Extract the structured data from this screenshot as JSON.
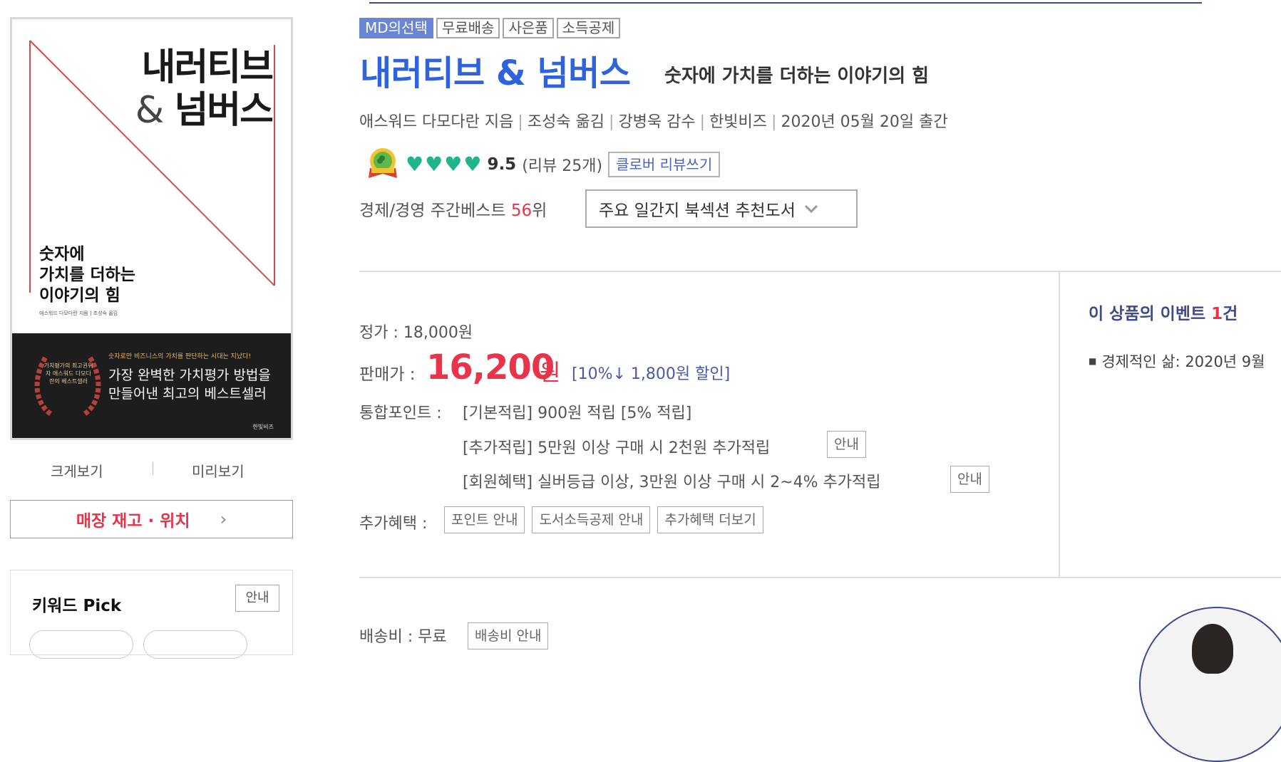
{
  "cover": {
    "title_line1": "내러티브",
    "title_amp": "&",
    "title_line2": "넘버스",
    "subtitle_lines": [
      "숫자에",
      "가치를 더하는",
      "이야기의 힘"
    ],
    "author_small": "애스워드 다모다란 지음 | 조성숙 옮김",
    "wreath_text": "가치평가의 최고권위자 애스워드 다모다란의 베스트셀러",
    "blurb_small": "숫자로만 비즈니스의 가치를 판단하는 시대는 지났다!",
    "blurb_large": "가장 완벽한 가치평가 방법을 만들어낸 최고의 베스트셀러",
    "publisher": "한빛비즈"
  },
  "view_links": {
    "large": "크게보기",
    "preview": "미리보기"
  },
  "stock_button": "매장 재고 · 위치",
  "keyword": {
    "title": "키워드 Pick",
    "guide": "안내"
  },
  "badges": [
    "MD의선택",
    "무료배송",
    "사은품",
    "소득공제"
  ],
  "product": {
    "title": "내러티브 & 넘버스",
    "subtitle": "숫자에 가치를 더하는 이야기의 힘",
    "author": "애스워드 다모다란 지음",
    "translator": "조성숙 옮김",
    "supervisor": "강병욱 감수",
    "publisher": "한빛비즈",
    "pub_date": "2020년 05월 20일 출간"
  },
  "rating": {
    "score": "9.5",
    "review_text": "(리뷰 25개)",
    "review_button": "클로버 리뷰쓰기",
    "hearts": 4
  },
  "bestseller": {
    "category": "경제/경영 주간베스트",
    "rank": "56",
    "suffix": "위"
  },
  "recommend_select": "주요 일간지 북섹션 추천도서",
  "price": {
    "list_label": "정가 : 18,000원",
    "sale_label": "판매가 :",
    "sale_value": "16,200",
    "sale_unit": "원",
    "discount": "[10%↓ 1,800원 할인]"
  },
  "points": {
    "label": "통합포인트 :",
    "basic": "[기본적립] 900원 적립 [5% 적립]",
    "extra": "[추가적립] 5만원 이상 구매 시 2천원 추가적립",
    "member": "[회원혜택] 실버등급 이상, 3만원 이상 구매 시 2~4% 추가적립",
    "guide": "안내"
  },
  "extra_benefits": {
    "label": "추가혜택 :",
    "buttons": [
      "포인트 안내",
      "도서소득공제 안내",
      "추가혜택 더보기"
    ]
  },
  "events": {
    "title_prefix": "이 상품의 이벤트 ",
    "count": "1",
    "title_suffix": "건",
    "items": [
      "경제적인 삶: 2020년 9월"
    ]
  },
  "shipping": {
    "label": "배송비 : 무료",
    "button": "배송비 안내"
  },
  "colors": {
    "accent_blue": "#2e63dd",
    "price_red": "#e8334a",
    "heart_green": "#1fb48c",
    "navy": "#3e4a8e"
  }
}
